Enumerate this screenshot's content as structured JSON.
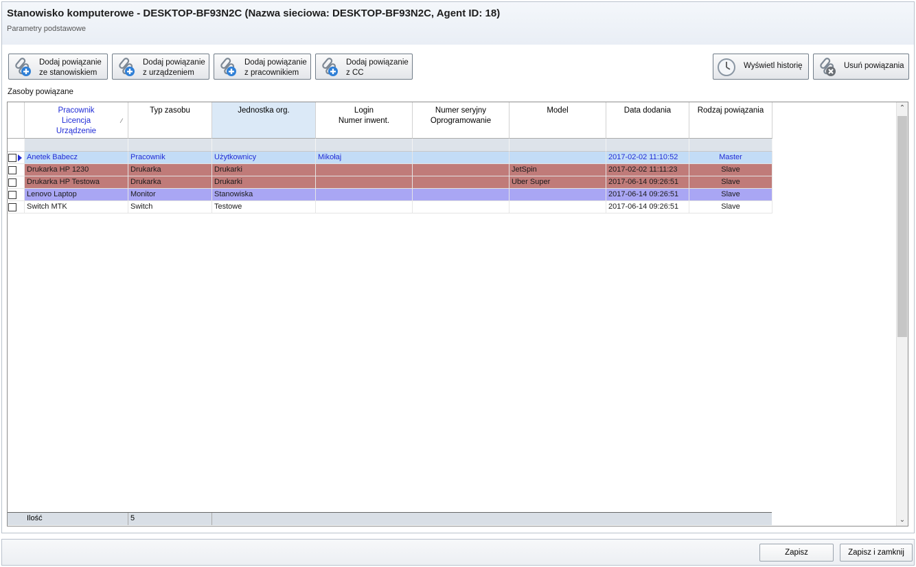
{
  "window": {
    "title": "Stanowisko komputerowe - DESKTOP-BF93N2C (Nazwa sieciowa: DESKTOP-BF93N2C, Agent ID: 18)",
    "subtitle": "Parametry podstawowe"
  },
  "toolbar": {
    "add_workstation": {
      "line1": "Dodaj powiązanie",
      "line2": "ze stanowiskiem",
      "icon": "link-add-icon"
    },
    "add_device": {
      "line1": "Dodaj powiązanie",
      "line2": "z urządzeniem",
      "icon": "link-add-icon"
    },
    "add_employee": {
      "line1": "Dodaj powiązanie",
      "line2": "z pracownikiem",
      "icon": "link-add-icon"
    },
    "add_cc": {
      "line1": "Dodaj powiązanie",
      "line2": "z CC",
      "icon": "link-add-icon"
    },
    "history": {
      "label": "Wyświetl historię",
      "icon": "clock-icon"
    },
    "remove": {
      "label": "Usuń powiązania",
      "icon": "link-remove-icon"
    }
  },
  "section_label": "Zasoby powiązane",
  "grid": {
    "headers": {
      "name": [
        "Pracownik",
        "Licencja",
        "Urządzenie"
      ],
      "type": [
        "Typ zasobu"
      ],
      "org": [
        "Jednostka org."
      ],
      "login": [
        "Login",
        "Numer inwent."
      ],
      "serial": [
        "Numer seryjny",
        "Oprogramowanie"
      ],
      "model": [
        "Model"
      ],
      "date": [
        "Data dodania"
      ],
      "relation": [
        "Rodzaj powiązania"
      ]
    },
    "sort_indicator": "⁄",
    "rows": [
      {
        "name": "Anetek Babecz",
        "type": "Pracownik",
        "org": "Użytkownicy",
        "login": "Mikołaj",
        "serial": "",
        "model": "",
        "date": "2017-02-02 11:10:52",
        "relation": "Master",
        "bg": "#c3dcf6",
        "fg": "#1f2bd6",
        "current": true
      },
      {
        "name": "Drukarka HP 1230",
        "type": "Drukarka",
        "org": "Drukarki",
        "login": "",
        "serial": "",
        "model": "JetSpin",
        "date": "2017-02-02 11:11:23",
        "relation": "Slave",
        "bg": "#c07b79",
        "fg": "#1a1a1a",
        "current": false
      },
      {
        "name": "Drukarka HP Testowa",
        "type": "Drukarka",
        "org": "Drukarki",
        "login": "",
        "serial": "",
        "model": "Uber Super",
        "date": "2017-06-14 09:26:51",
        "relation": "Slave",
        "bg": "#c07b79",
        "fg": "#1a1a1a",
        "current": false
      },
      {
        "name": "Lenovo Laptop",
        "type": "Monitor",
        "org": "Stanowiska",
        "login": "",
        "serial": "",
        "model": "",
        "date": "2017-06-14 09:26:51",
        "relation": "Slave",
        "bg": "#a9a6f4",
        "fg": "#1a1a1a",
        "current": false
      },
      {
        "name": "Switch MTK",
        "type": "Switch",
        "org": "Testowe",
        "login": "",
        "serial": "",
        "model": "",
        "date": "2017-06-14 09:26:51",
        "relation": "Slave",
        "bg": "#ffffff",
        "fg": "#1a1a1a",
        "current": false
      }
    ],
    "footer": {
      "label": "Ilość",
      "count": "5"
    }
  },
  "buttons": {
    "save": "Zapisz",
    "save_close": "Zapisz i zamknij"
  }
}
